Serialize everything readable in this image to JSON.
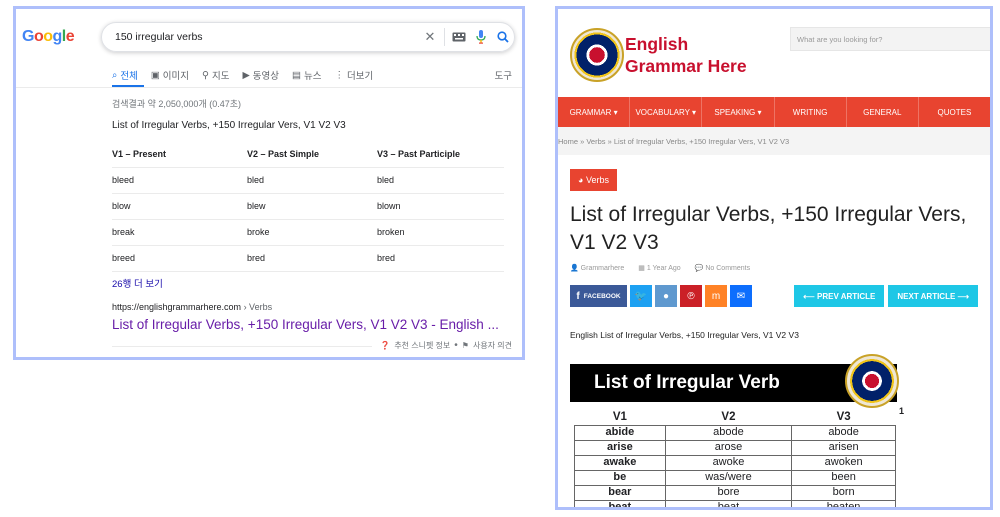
{
  "google": {
    "logo": [
      "G",
      "o",
      "o",
      "g",
      "l",
      "e"
    ],
    "query": "150 irregular verbs",
    "tabs": [
      {
        "label": "전체",
        "icon": "search-icon"
      },
      {
        "label": "이미지",
        "icon": "image-icon"
      },
      {
        "label": "지도",
        "icon": "map-pin-icon"
      },
      {
        "label": "동영상",
        "icon": "video-icon"
      },
      {
        "label": "뉴스",
        "icon": "news-icon"
      },
      {
        "label": "더보기",
        "icon": "more-icon"
      }
    ],
    "tools_label": "도구",
    "stats": "검색결과 약 2,050,000개 (0.47초)",
    "snippet_title": "List of Irregular Verbs, +150 Irregular Vers, V1 V2 V3",
    "table": {
      "headers": [
        "V1 – Present",
        "V2 – Past Simple",
        "V3 – Past Participle"
      ],
      "rows": [
        [
          "bleed",
          "bled",
          "bled"
        ],
        [
          "blow",
          "blew",
          "blown"
        ],
        [
          "break",
          "broke",
          "broken"
        ],
        [
          "breed",
          "bred",
          "bred"
        ]
      ]
    },
    "more_rows": "26행 더 보기",
    "result_url": "https://englishgrammarhere.com",
    "result_crumb": " › Verbs",
    "result_title": "List of Irregular Verbs, +150 Irregular Vers, V1 V2 V3 - English ...",
    "footer_snippet": "추천 스니펫 정보",
    "footer_feedback": "사용자 의견"
  },
  "site": {
    "name_line1": "English",
    "name_line2": "Grammar Here",
    "search_placeholder": "What are you looking for?",
    "nav": [
      "GRAMMAR ▾",
      "VOCABULARY ▾",
      "SPEAKING ▾",
      "WRITING",
      "GENERAL",
      "QUOTES"
    ],
    "breadcrumb": "Home »  Verbs  »  List of Irregular Verbs, +150 Irregular Vers, V1 V2 V3",
    "category": "Verbs",
    "title": "List of Irregular Verbs, +150 Irregular Vers, V1 V2 V3",
    "author": "Grammarhere",
    "date": "1 Year Ago",
    "comments": "No Comments",
    "facebook_label": "FACEBOOK",
    "prev_label": "⟵ PREV ARTICLE",
    "next_label": "NEXT ARTICLE ⟶",
    "intro": "English List of Irregular Verbs, +150 Irregular Vers, V1 V2 V3",
    "figure": {
      "heading": "List of Irregular Verb",
      "page_number": "1",
      "headers": [
        "V1",
        "V2",
        "V3"
      ],
      "rows": [
        [
          "abide",
          "abode",
          "abode"
        ],
        [
          "arise",
          "arose",
          "arisen"
        ],
        [
          "awake",
          "awoke",
          "awoken"
        ],
        [
          "be",
          "was/were",
          "been"
        ],
        [
          "bear",
          "bore",
          "born"
        ],
        [
          "beat",
          "beat",
          "beaten"
        ]
      ]
    }
  },
  "colors": {
    "google_blue": "#1a73e8",
    "visited_purple": "#681da8",
    "site_red": "#e84430",
    "share_cyan": "#1ec7e6"
  }
}
